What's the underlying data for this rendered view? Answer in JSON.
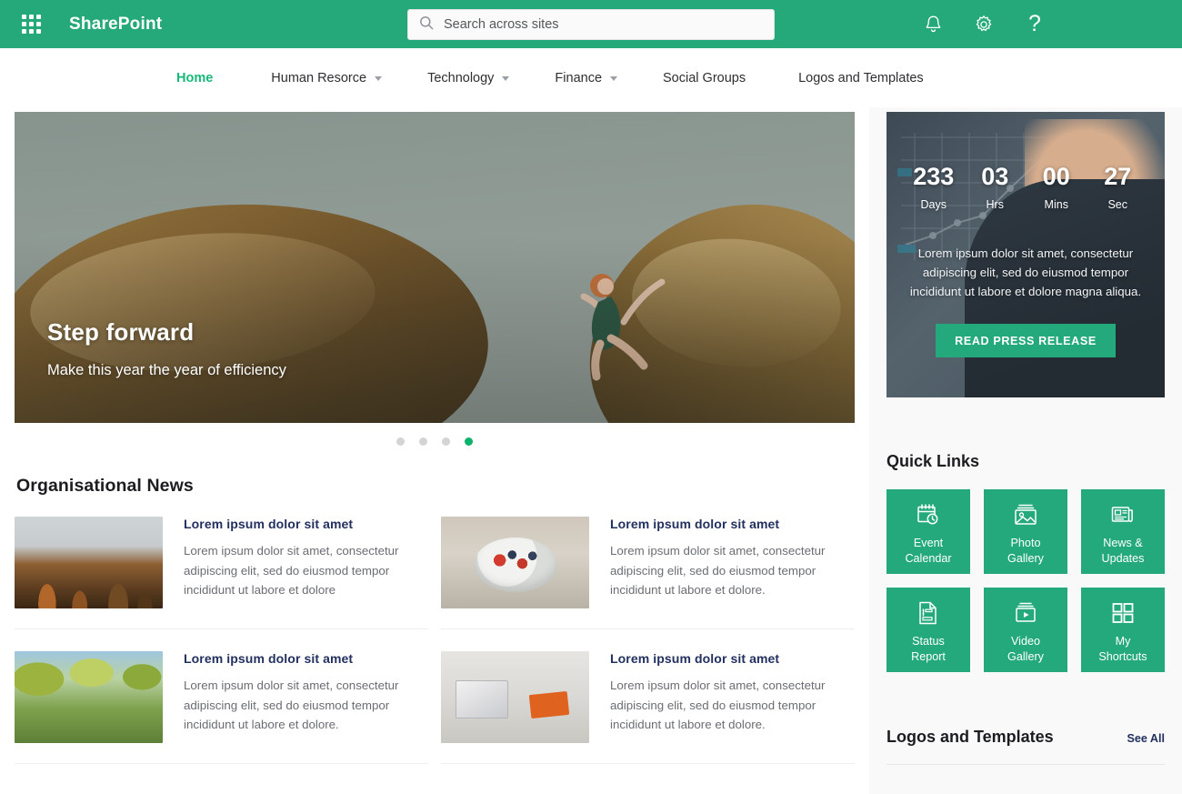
{
  "topbar": {
    "waffle_icon": "app-launcher-waffle-icon",
    "brand": "SharePoint",
    "search": {
      "icon": "search-icon",
      "placeholder": "Search across sites",
      "value": ""
    },
    "icons": [
      {
        "name": "notifications-bell-icon",
        "glyph": "bell"
      },
      {
        "name": "settings-gear-icon",
        "glyph": "gear"
      },
      {
        "name": "help-question-icon",
        "glyph": "?"
      }
    ]
  },
  "nav": {
    "items": [
      {
        "label": "Home",
        "active": true,
        "has_caret": false
      },
      {
        "label": "Human Resorce",
        "active": false,
        "has_caret": true
      },
      {
        "label": "Technology",
        "active": false,
        "has_caret": true
      },
      {
        "label": "Finance",
        "active": false,
        "has_caret": true
      },
      {
        "label": "Social Groups",
        "active": false,
        "has_caret": false
      },
      {
        "label": "Logos and Templates",
        "active": false,
        "has_caret": false
      }
    ]
  },
  "hero": {
    "title": "Step forward",
    "subtitle": "Make this year the year of efficiency",
    "dots": [
      {
        "active": false
      },
      {
        "active": false
      },
      {
        "active": false
      },
      {
        "active": true
      }
    ]
  },
  "news": {
    "section_title": "Organisational News",
    "cards": [
      {
        "headline": "Lorem ipsum dolor sit amet",
        "body": "Lorem ipsum dolor sit amet, consectetur adipiscing elit, sed do eiusmod tempor incididunt ut labore et dolore",
        "thumb": "forest-birds-photo"
      },
      {
        "headline": "Lorem ipsum dolor sit amet",
        "body": "Lorem ipsum dolor sit amet, consectetur adipiscing elit, sed do eiusmod tempor incididunt ut labore et dolore.",
        "thumb": "berries-bowl-photo"
      },
      {
        "headline": "Lorem ipsum dolor sit amet",
        "body": "Lorem ipsum dolor sit amet, consectetur adipiscing elit, sed do eiusmod tempor incididunt ut labore et dolore.",
        "thumb": "park-family-photo"
      },
      {
        "headline": "Lorem ipsum dolor sit amet",
        "body": "Lorem ipsum dolor sit amet, consectetur adipiscing elit, sed do eiusmod tempor incididunt ut labore et dolore.",
        "thumb": "desk-laptop-photo"
      }
    ]
  },
  "countdown": {
    "units": [
      {
        "value": "233",
        "label": "Days"
      },
      {
        "value": "03",
        "label": "Hrs"
      },
      {
        "value": "00",
        "label": "Mins"
      },
      {
        "value": "27",
        "label": "Sec"
      }
    ],
    "description": "Lorem ipsum dolor sit amet, consectetur adipiscing elit, sed do eiusmod tempor incididunt ut labore et dolore magna aliqua.",
    "button_label": "READ PRESS RELEASE"
  },
  "quick_links": {
    "title": "Quick Links",
    "tiles": [
      {
        "label": "Event\nCalendar",
        "line1": "Event",
        "line2": "Calendar",
        "icon": "calendar-clock-icon"
      },
      {
        "label": "Photo Gallery",
        "line1": "Photo",
        "line2": "Gallery",
        "icon": "photo-image-icon"
      },
      {
        "label": "News & Updates",
        "line1": "News &",
        "line2": "Updates",
        "icon": "newspaper-icon"
      },
      {
        "label": "Status Report",
        "line1": "Status",
        "line2": "Report",
        "icon": "document-report-icon"
      },
      {
        "label": "Video Gallery",
        "line1": "Video",
        "line2": "Gallery",
        "icon": "video-play-icon"
      },
      {
        "label": "My Shortcuts",
        "line1": "My",
        "line2": "Shortcuts",
        "icon": "grid-squares-icon"
      }
    ]
  },
  "logos_templates": {
    "title": "Logos and Templates",
    "see_all": "See All"
  },
  "colors": {
    "header_green": "#25a97a",
    "accent_green": "#24a97c",
    "active_nav_green": "#17b978",
    "dot_active_green": "#0ab26b",
    "headline_navy": "#22305e",
    "sidebar_bg": "#f9f9f9"
  }
}
